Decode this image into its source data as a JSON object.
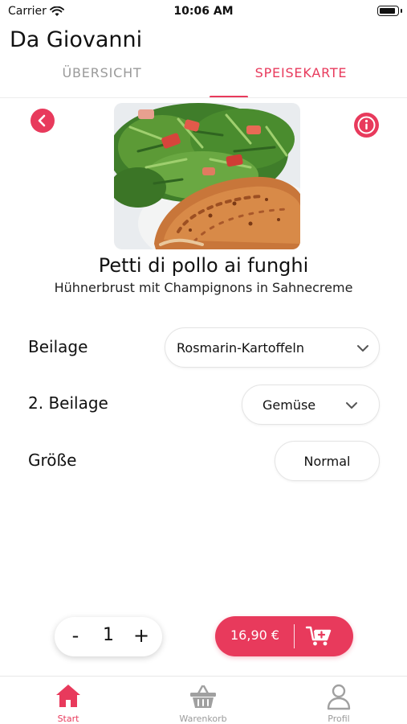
{
  "status_bar": {
    "carrier": "Carrier",
    "time": "10:06 AM"
  },
  "header": {
    "restaurant_name": "Da Giovanni"
  },
  "tabs": [
    {
      "label": "ÜBERSICHT",
      "active": false
    },
    {
      "label": "SPEISEKARTE",
      "active": true
    }
  ],
  "dish": {
    "title": "Petti di pollo ai funghi",
    "subtitle": "Hühnerbrust mit Champignons in Sahnecreme",
    "image_icon": "dish-photo"
  },
  "options": [
    {
      "label": "Beilage",
      "value": "Rosmarin-Kartoffeln",
      "has_dropdown": true
    },
    {
      "label": "2. Beilage",
      "value": "Gemüse",
      "has_dropdown": true
    },
    {
      "label": "Größe",
      "value": "Normal",
      "has_dropdown": false
    }
  ],
  "quantity": {
    "minus_label": "-",
    "value": "1",
    "plus_label": "+"
  },
  "cart_button": {
    "price": "16,90 €",
    "icon": "cart-add-icon"
  },
  "bottom_nav": [
    {
      "label": "Start",
      "icon": "home-icon",
      "active": true
    },
    {
      "label": "Warenkorb",
      "icon": "basket-icon",
      "active": false
    },
    {
      "label": "Profil",
      "icon": "user-icon",
      "active": false
    }
  ],
  "colors": {
    "accent": "#e83a5c",
    "inactive": "#9b9b9b",
    "text": "#111111"
  }
}
